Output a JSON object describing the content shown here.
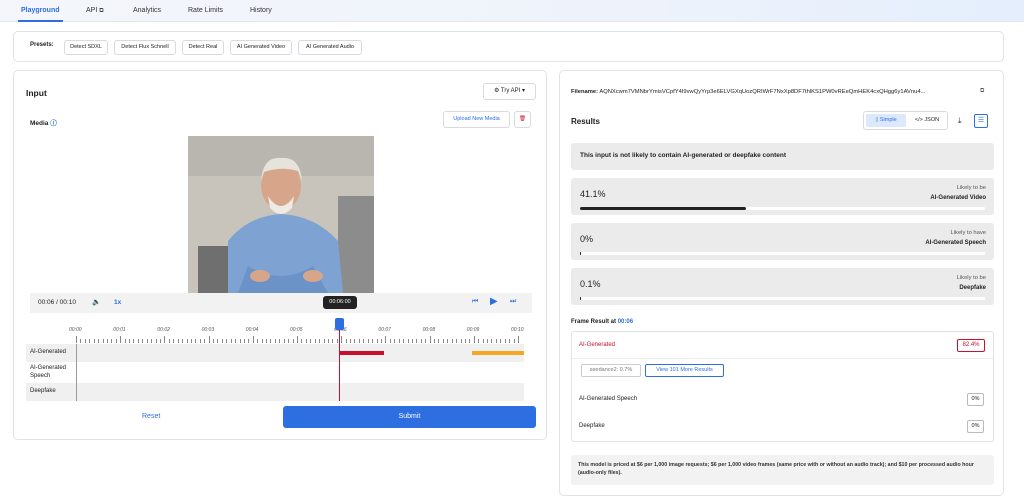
{
  "tabs": [
    {
      "label": "Playground"
    },
    {
      "label": "API"
    },
    {
      "label": "Analytics"
    },
    {
      "label": "Rate Limits"
    },
    {
      "label": "History"
    }
  ],
  "presets": {
    "label": "Presets:",
    "items": [
      "Detect SDXL",
      "Detect Flux Schnell",
      "Detect Real",
      "AI Generated Video",
      "AI Generated Audio"
    ]
  },
  "input": {
    "title": "Input",
    "try_api": "Try API",
    "media_label": "Media",
    "upload": "Upload New Media",
    "player": {
      "time": "00:06 / 00:10",
      "speed": "1x",
      "tooltip": "00:06:00"
    },
    "timeline": {
      "ticks": [
        "00:00",
        "00:01",
        "00:02",
        "00:03",
        "00:04",
        "00:05",
        "00:06",
        "00:07",
        "00:08",
        "00:09",
        "00:10"
      ],
      "rows": [
        "AI-Generated",
        "AI-Generated Speech",
        "Deepfake"
      ]
    },
    "reset": "Reset",
    "submit": "Submit"
  },
  "results": {
    "filename_label": "Filename:",
    "filename": "AQNXcwm7VMNbrYmisVCpfY4I9vwQyYrp3e6ELVGXqUozQRIWrF7NxXp8DF7thlKS1PW0vREeQmHEK4cxQHgg6y1AVnu4...",
    "title": "Results",
    "simple": "Simple",
    "json": "</> JSON",
    "summary": "This input is not likely to contain AI-generated or deepfake content",
    "items": [
      {
        "pct": "41.1%",
        "value": 0.411,
        "likely": "Likely to be",
        "label": "AI-Generated Video"
      },
      {
        "pct": "0%",
        "value": 0,
        "likely": "Likely to have",
        "label": "AI-Generated Speech"
      },
      {
        "pct": "0.1%",
        "value": 0.001,
        "likely": "Likely to be",
        "label": "Deepfake"
      }
    ],
    "frame": {
      "label": "Frame Result at",
      "time": "00:06",
      "ai_label": "AI-Generated",
      "ai_value": "82.4%",
      "tag": "seedance2: 0.7%",
      "more": "View 101 More Results",
      "speech_label": "AI-Generated Speech",
      "speech_value": "0%",
      "deepfake_label": "Deepfake",
      "deepfake_value": "0%"
    },
    "pricing": "This model is priced at $6 per 1,000 image requests; $6 per 1,000 video frames (same price with or without an audio track); and $10 per processed audio hour (audio-only files)."
  },
  "colors": {
    "accent": "#2d6fe0",
    "red": "#c8102e",
    "orange": "#f5a623"
  }
}
